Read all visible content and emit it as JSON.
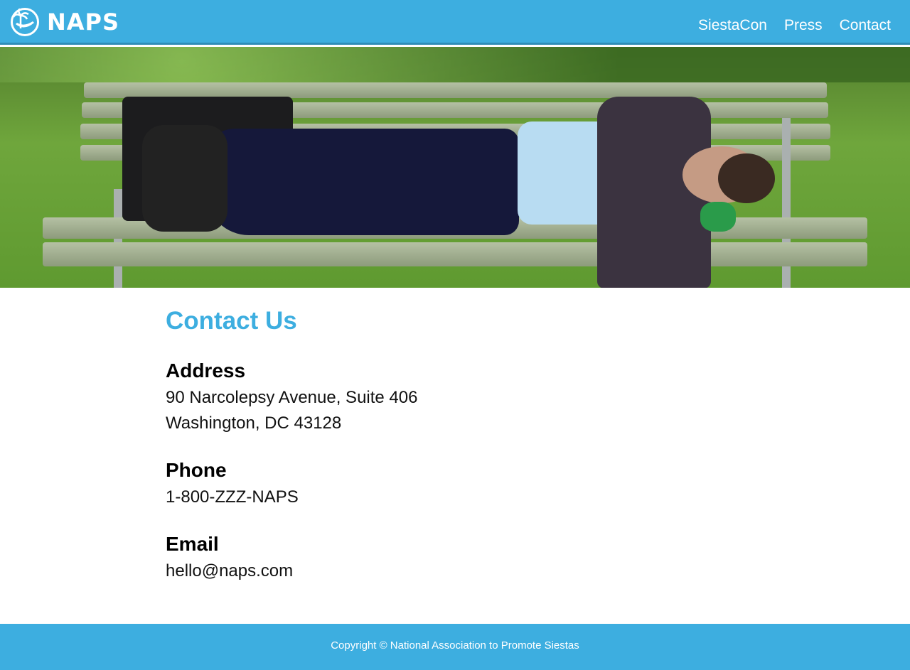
{
  "header": {
    "logo_text": "NAPS",
    "nav": [
      {
        "label": "SiestaCon"
      },
      {
        "label": "Press"
      },
      {
        "label": "Contact"
      }
    ]
  },
  "hero": {
    "image": "man-napping-on-park-bench"
  },
  "main": {
    "title": "Contact Us",
    "sections": [
      {
        "heading": "Address",
        "lines": [
          "90 Narcolepsy Avenue, Suite 406",
          "Washington, DC 43128"
        ]
      },
      {
        "heading": "Phone",
        "lines": [
          "1-800-ZZZ-NAPS"
        ]
      },
      {
        "heading": "Email",
        "lines": [
          "hello@naps.com"
        ]
      }
    ]
  },
  "footer": {
    "text": "Copyright © National Association to Promote Siestas"
  },
  "colors": {
    "brand": "#3daee0"
  }
}
